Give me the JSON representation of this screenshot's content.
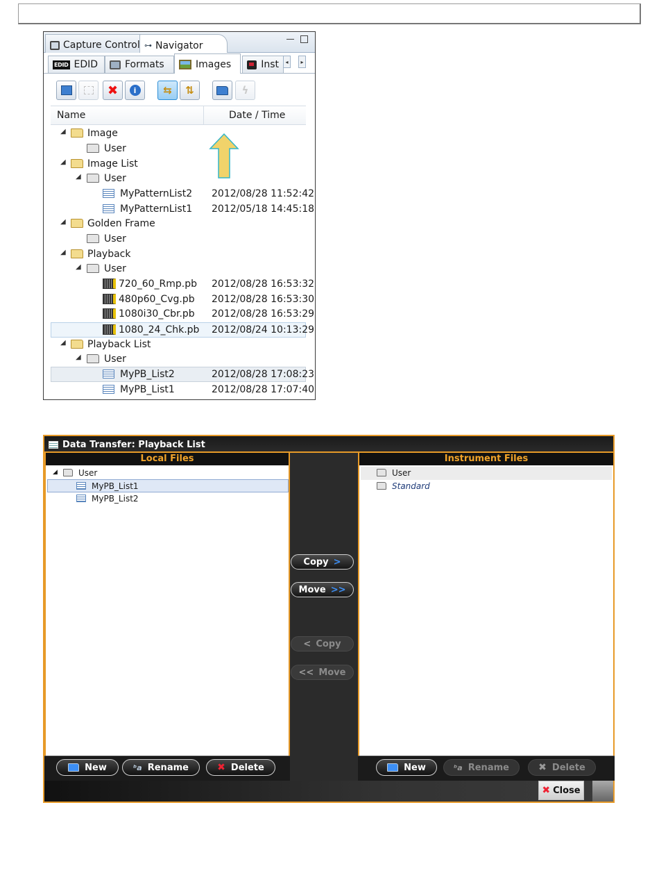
{
  "navigator": {
    "view_tabs": [
      {
        "label": "Capture Control",
        "icon": "capture-icon"
      },
      {
        "label": "Navigator",
        "icon": "navigator-icon"
      }
    ],
    "sub_tabs": [
      {
        "label": "EDID",
        "icon_text": "EDID"
      },
      {
        "label": "Formats"
      },
      {
        "label": "Images"
      },
      {
        "label": "Inst"
      }
    ],
    "columns": {
      "name": "Name",
      "date": "Date / Time"
    },
    "tree": [
      {
        "label": "Image",
        "date": ""
      },
      {
        "label": "User",
        "date": ""
      },
      {
        "label": "Image List",
        "date": ""
      },
      {
        "label": "User",
        "date": ""
      },
      {
        "label": "MyPatternList2",
        "date": "2012/08/28 11:52:42"
      },
      {
        "label": "MyPatternList1",
        "date": "2012/05/18 14:45:18"
      },
      {
        "label": "Golden Frame",
        "date": ""
      },
      {
        "label": "User",
        "date": ""
      },
      {
        "label": "Playback",
        "date": ""
      },
      {
        "label": "User",
        "date": ""
      },
      {
        "label": "720_60_Rmp.pb",
        "date": "2012/08/28 16:53:32"
      },
      {
        "label": "480p60_Cvg.pb",
        "date": "2012/08/28 16:53:30"
      },
      {
        "label": "1080i30_Cbr.pb",
        "date": "2012/08/28 16:53:29"
      },
      {
        "label": "1080_24_Chk.pb",
        "date": "2012/08/24 10:13:29"
      },
      {
        "label": "Playback List",
        "date": ""
      },
      {
        "label": "User",
        "date": ""
      },
      {
        "label": "MyPB_List2",
        "date": "2012/08/28 17:08:23"
      },
      {
        "label": "MyPB_List1",
        "date": "2012/08/28 17:07:40"
      }
    ]
  },
  "dialog": {
    "title": "Data Transfer: Playback List",
    "local": {
      "header": "Local Files",
      "items": [
        {
          "label": "User"
        },
        {
          "label": "MyPB_List1"
        },
        {
          "label": "MyPB_List2"
        }
      ],
      "buttons": {
        "new": "New",
        "rename": "Rename",
        "delete": "Delete"
      }
    },
    "instrument": {
      "header": "Instrument Files",
      "items": [
        {
          "label": "User"
        },
        {
          "label": "Standard"
        }
      ],
      "buttons": {
        "new": "New",
        "rename": "Rename",
        "delete": "Delete"
      }
    },
    "transfer": {
      "copy_to_instrument": "Copy",
      "move_to_instrument": "Move",
      "copy_to_local": "Copy",
      "move_to_local": "Move"
    },
    "close": "Close"
  },
  "colors": {
    "accent": "#e79a28",
    "dialog_bg": "#1f1f1f",
    "highlight": "#2d8ed6",
    "arrow": "#f1d36a"
  }
}
